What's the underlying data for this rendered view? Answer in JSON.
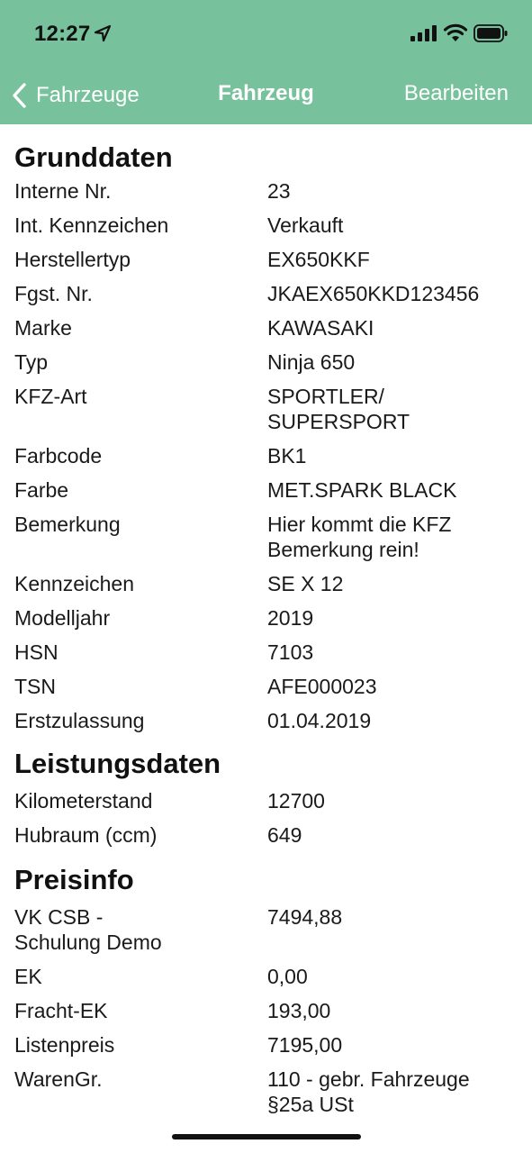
{
  "status_bar": {
    "time": "12:27",
    "icons": [
      "location-arrow-icon",
      "cellular-signal-icon",
      "wifi-icon",
      "battery-icon"
    ]
  },
  "nav": {
    "back_label": "Fahrzeuge",
    "title": "Fahrzeug",
    "edit_label": "Bearbeiten"
  },
  "colors": {
    "header_background": "#77c29c",
    "header_text": "#ffffff",
    "content_text": "#1a1a1a"
  },
  "sections": {
    "grunddaten": {
      "title": "Grunddaten",
      "rows": [
        {
          "label": "Interne Nr.",
          "value": "23"
        },
        {
          "label": "Int. Kennzeichen",
          "value": "Verkauft"
        },
        {
          "label": "Herstellertyp",
          "value": "EX650KKF"
        },
        {
          "label": "Fgst. Nr.",
          "value": "JKAEX650KKD123456"
        },
        {
          "label": "Marke",
          "value": "KAWASAKI"
        },
        {
          "label": "Typ",
          "value": "Ninja 650"
        },
        {
          "label": "KFZ-Art",
          "value": "SPORTLER/\nSUPERSPORT"
        },
        {
          "label": "Farbcode",
          "value": "BK1"
        },
        {
          "label": "Farbe",
          "value": "MET.SPARK BLACK"
        },
        {
          "label": "Bemerkung",
          "value": "Hier kommt die KFZ\nBemerkung rein!"
        },
        {
          "label": "Kennzeichen",
          "value": "SE X 12"
        },
        {
          "label": "Modelljahr",
          "value": "2019"
        },
        {
          "label": "HSN",
          "value": "7103"
        },
        {
          "label": "TSN",
          "value": "AFE000023"
        },
        {
          "label": "Erstzulassung",
          "value": "01.04.2019"
        }
      ]
    },
    "leistungsdaten": {
      "title": "Leistungsdaten",
      "rows": [
        {
          "label": "Kilometerstand",
          "value": "12700"
        },
        {
          "label": "Hubraum (ccm)",
          "value": "649"
        }
      ]
    },
    "preisinfo": {
      "title": "Preisinfo",
      "rows": [
        {
          "label": "VK CSB -\nSchulung Demo",
          "value": "7494,88"
        },
        {
          "label": "EK",
          "value": "0,00"
        },
        {
          "label": "Fracht-EK",
          "value": "193,00"
        },
        {
          "label": "Listenpreis",
          "value": "7195,00"
        },
        {
          "label": "WarenGr.",
          "value": "110 - gebr. Fahrzeuge\n§25a USt"
        }
      ]
    }
  }
}
